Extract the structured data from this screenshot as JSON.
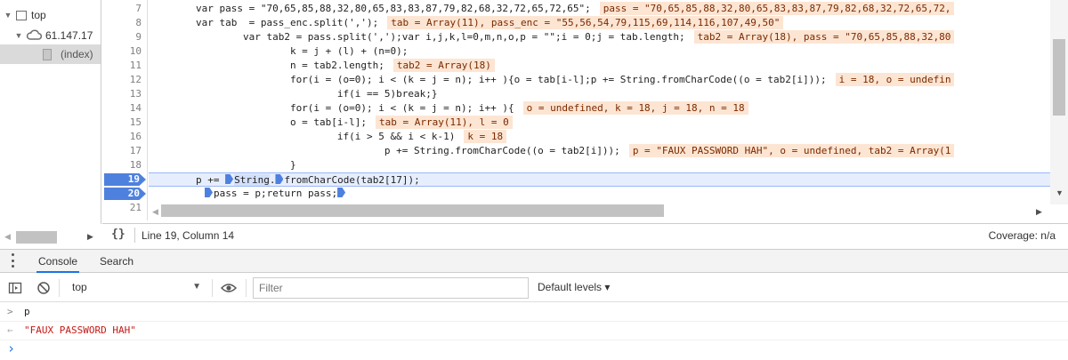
{
  "file_tree": {
    "items": [
      {
        "label": "top",
        "level": 0,
        "expanded": true,
        "icon": "frame-icon"
      },
      {
        "label": "61.147.17",
        "level": 1,
        "expanded": true,
        "icon": "cloud-icon"
      },
      {
        "label": "(index)",
        "level": 2,
        "selected": true,
        "icon": "file-icon"
      }
    ]
  },
  "editor": {
    "lines": [
      {
        "num": "7",
        "code": "        var pass = \"70,65,85,88,32,80,65,83,83,87,79,82,68,32,72,65,72,65\";",
        "inline": "pass = \"70,65,85,88,32,80,65,83,83,87,79,82,68,32,72,65,72,"
      },
      {
        "num": "8",
        "code": "        var tab  = pass_enc.split(',');",
        "inline": "tab = Array(11), pass_enc = \"55,56,54,79,115,69,114,116,107,49,50\""
      },
      {
        "num": "9",
        "code": "                var tab2 = pass.split(',');var i,j,k,l=0,m,n,o,p = \"\";i = 0;j = tab.length;",
        "inline": "tab2 = Array(18), pass = \"70,65,85,88,32,80"
      },
      {
        "num": "10",
        "code": "                        k = j + (l) + (n=0);",
        "inline": ""
      },
      {
        "num": "11",
        "code": "                        n = tab2.length;",
        "inline": "tab2 = Array(18)"
      },
      {
        "num": "12",
        "code": "                        for(i = (o=0); i < (k = j = n); i++ ){o = tab[i-l];p += String.fromCharCode((o = tab2[i]));",
        "inline": "i = 18, o = undefin"
      },
      {
        "num": "13",
        "code": "                                if(i == 5)break;}",
        "inline": ""
      },
      {
        "num": "14",
        "code": "                        for(i = (o=0); i < (k = j = n); i++ ){",
        "inline": "o = undefined, k = 18, j = 18, n = 18"
      },
      {
        "num": "15",
        "code": "                        o = tab[i-l];",
        "inline": "tab = Array(11), l = 0"
      },
      {
        "num": "16",
        "code": "                                if(i > 5 && i < k-1)",
        "inline": "k = 18"
      },
      {
        "num": "17",
        "code": "                                        p += String.fromCharCode((o = tab2[i]));",
        "inline": "p = \"FAUX PASSWORD HAH\", o = undefined, tab2 = Array(1"
      },
      {
        "num": "18",
        "code": "                        }",
        "inline": ""
      },
      {
        "num": "19",
        "code": "        p += ",
        "code_b": "String",
        "code_c": ".",
        "code_d": "fromCharCode(tab2[17]);",
        "inline": "",
        "breakpoint": true
      },
      {
        "num": "20",
        "code": "",
        "code_b": "pass = p;return pass;",
        "inline": "",
        "breakpoint": true
      },
      {
        "num": "21",
        "code": "",
        "inline": ""
      }
    ]
  },
  "status_bar": {
    "braces": "{}",
    "position": "Line 19, Column 14",
    "coverage": "Coverage: n/a"
  },
  "drawer": {
    "tabs": [
      {
        "label": "Console",
        "active": true
      },
      {
        "label": "Search",
        "active": false
      }
    ]
  },
  "console_toolbar": {
    "context": "top",
    "filter_placeholder": "Filter",
    "levels": "Default levels ▾"
  },
  "console_output": {
    "rows": [
      {
        "prompt": ">",
        "text": "p",
        "kind": "input"
      },
      {
        "prompt": "←",
        "text": "\"FAUX PASSWORD HAH\"",
        "kind": "result"
      },
      {
        "prompt": "›",
        "text": "",
        "kind": "prompt"
      }
    ]
  },
  "colors": {
    "accent": "#1a73e8",
    "breakpoint": "#4e81de",
    "exec_line": "#e6eefe",
    "inline_value_bg": "#fde5d3",
    "string": "#c41a16"
  }
}
